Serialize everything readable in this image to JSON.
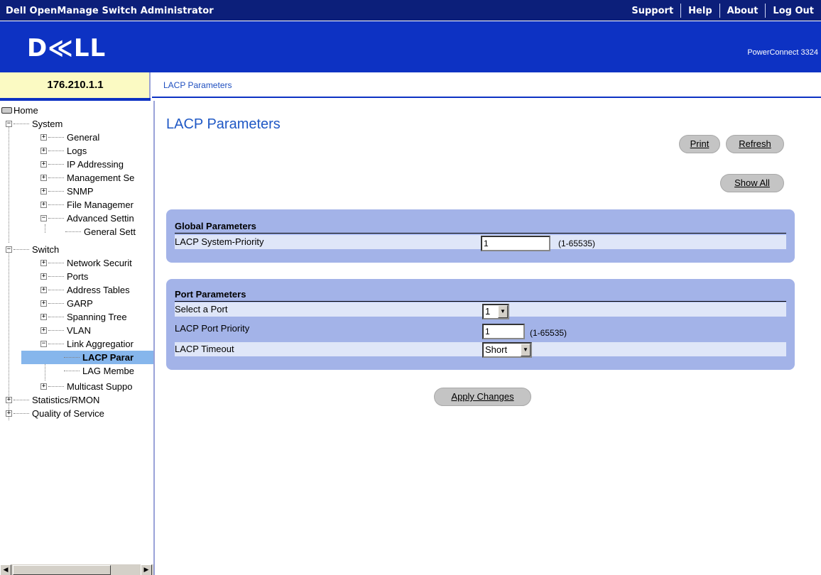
{
  "app": {
    "title": "Dell OpenManage Switch Administrator"
  },
  "toplinks": [
    "Support",
    "Help",
    "About",
    "Log Out"
  ],
  "header": {
    "logo": "D≪LL",
    "product": "PowerConnect 3324"
  },
  "ip_address": "176.210.1.1",
  "breadcrumb": "LACP Parameters",
  "nav": {
    "home": "Home",
    "system": "System",
    "general": "General",
    "logs": "Logs",
    "ip_addressing": "IP Addressing",
    "management_security": "Management Se",
    "snmp": "SNMP",
    "file_management": "File Managemer",
    "advanced_settings": "Advanced Settin",
    "general_settings": "General Sett",
    "switch": "Switch",
    "network_security": "Network Securit",
    "ports": "Ports",
    "address_tables": "Address Tables",
    "garp": "GARP",
    "spanning_tree": "Spanning Tree",
    "vlan": "VLAN",
    "link_aggregation": "Link Aggregatior",
    "lacp_parameters": "LACP Parar",
    "lag_membership": "LAG Membe",
    "multicast_support": "Multicast Suppo",
    "statistics_rmon": "Statistics/RMON",
    "quality_of_service": "Quality of Service"
  },
  "main": {
    "title": "LACP Parameters",
    "print_label": "Print",
    "refresh_label": "Refresh",
    "show_all_label": "Show All",
    "apply_label": "Apply Changes"
  },
  "global_params": {
    "heading": "Global Parameters",
    "system_priority_label": "LACP System-Priority",
    "system_priority_value": "1",
    "system_priority_range": "(1-65535)"
  },
  "port_params": {
    "heading": "Port Parameters",
    "select_port_label": "Select a Port",
    "select_port_value": "1",
    "port_priority_label": "LACP Port Priority",
    "port_priority_value": "1",
    "port_priority_range": "(1-65535)",
    "timeout_label": "LACP Timeout",
    "timeout_value": "Short"
  }
}
